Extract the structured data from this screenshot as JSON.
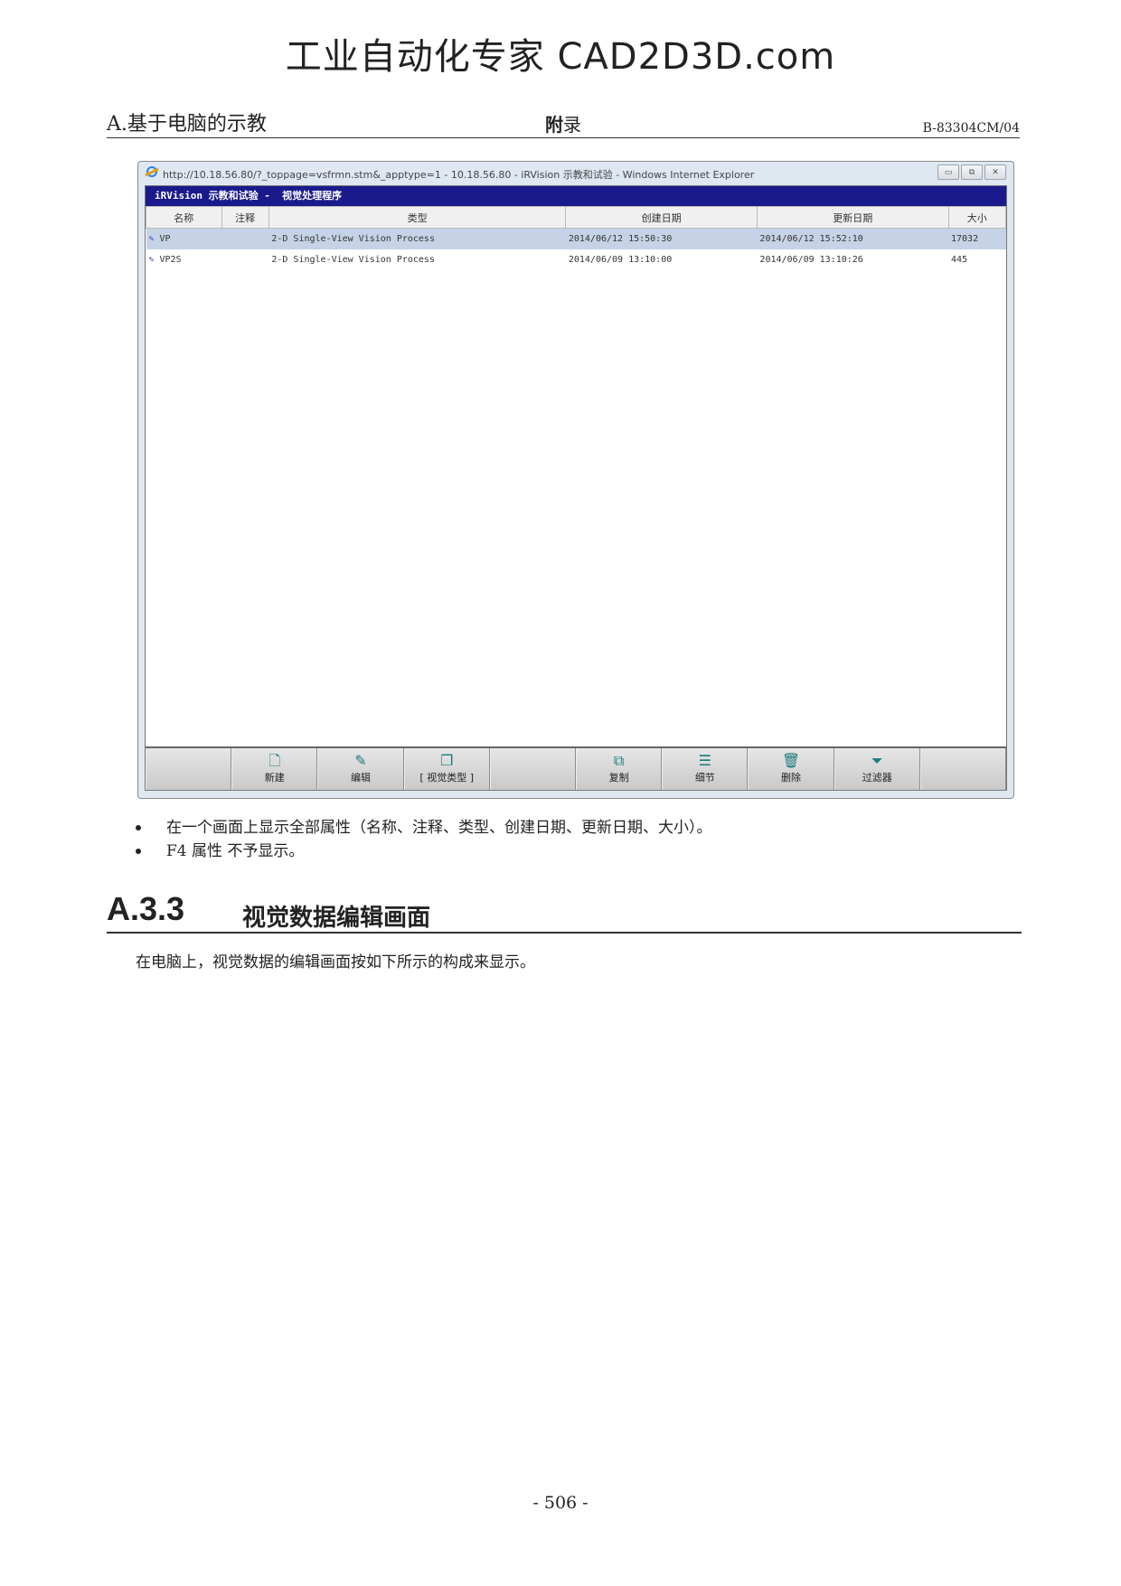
{
  "watermark": "工业自动化专家 CAD2D3D.com",
  "header": {
    "left": "A.基于电脑的示教",
    "center_bold": "附",
    "center_rest": "录",
    "right": "B-83304CM/04"
  },
  "window": {
    "title": "http://10.18.56.80/?_toppage=vsfrmn.stm&_apptype=1 - 10.18.56.80 - iRVision 示教和试验 - Windows Internet Explorer",
    "controls": {
      "minimize": "▭",
      "restore": "⧉",
      "close": "✕"
    },
    "app_title": "iRVision 示教和试验 -  视觉处理程序",
    "columns": [
      "名称",
      "注释",
      "类型",
      "创建日期",
      "更新日期",
      "大小"
    ],
    "rows": [
      {
        "name": "VP",
        "comment": "",
        "type": "2-D Single-View Vision Process",
        "created": "2014/06/12 15:50:30",
        "updated": "2014/06/12 15:52:10",
        "size": "17032"
      },
      {
        "name": "VP2S",
        "comment": "",
        "type": "2-D Single-View Vision Process",
        "created": "2014/06/09 13:10:00",
        "updated": "2014/06/09 13:10:26",
        "size": "445"
      }
    ],
    "toolbar": [
      {
        "label": "",
        "icon": ""
      },
      {
        "label": "新建",
        "icon": "new-icon"
      },
      {
        "label": "编辑",
        "icon": "edit-icon"
      },
      {
        "label": "[ 视觉类型 ]",
        "icon": "vision-type-icon"
      },
      {
        "label": "",
        "icon": ""
      },
      {
        "label": "复制",
        "icon": "copy-icon"
      },
      {
        "label": "细节",
        "icon": "detail-icon"
      },
      {
        "label": "删除",
        "icon": "delete-icon"
      },
      {
        "label": "过滤器",
        "icon": "filter-icon"
      },
      {
        "label": "",
        "icon": ""
      }
    ]
  },
  "bullets": [
    "在一个画面上显示全部属性（名称、注释、类型、创建日期、更新日期、大小）。",
    "F4  属性  不予显示。"
  ],
  "section": {
    "number": "A.3.3",
    "title": "视觉数据编辑画面"
  },
  "paragraph": "在电脑上，视觉数据的编辑画面按如下所示的构成来显示。",
  "page_number": "- 506 -"
}
